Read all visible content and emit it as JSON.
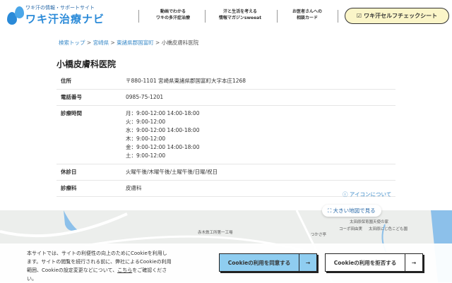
{
  "header": {
    "logo_sub": "ワキ汗の情報・サポートサイト",
    "logo_main": "ワキ汗治療ナビ",
    "nav": [
      {
        "line1": "動画でわかる",
        "line2": "ワキの多汗症治療"
      },
      {
        "line1": "汗と生活を考える",
        "line2": "情報マガジンsweeat"
      },
      {
        "line1": "お医者さんへの",
        "line2": "相談カード"
      }
    ],
    "check_icon": "☑",
    "check_label": "ワキ汗セルフチェックシート"
  },
  "breadcrumb": [
    {
      "label": "検索トップ"
    },
    {
      "label": "宮崎県"
    },
    {
      "label": "東諸県郡国富町"
    },
    {
      "label": "小橋皮膚科医院"
    }
  ],
  "breadcrumb_sep": ">",
  "clinic": {
    "name": "小橋皮膚科医院",
    "rows": {
      "address": {
        "k": "住所",
        "v": "〒880-1101 宮崎県東諸県郡国富町大字本庄1268"
      },
      "phone": {
        "k": "電話番号",
        "v": "0985-75-1201"
      },
      "hours": {
        "k": "診療時間",
        "v": [
          "月：9:00-12:00 14:00-18:00",
          "火：9:00-12:00",
          "水：9:00-12:00 14:00-18:00",
          "木：9:00-12:00",
          "金：9:00-12:00 14:00-18:00",
          "土：9:00-12:00"
        ]
      },
      "closed": {
        "k": "休診日",
        "v": "火曜午後/木曜午後/土曜午後/日曜/祝日"
      },
      "dept": {
        "k": "診療科",
        "v": "皮膚科"
      }
    }
  },
  "icon_link": "アイコンについて",
  "map": {
    "big_map": "大きい地図で見る",
    "labels": [
      "赤木鉄工所第一工場",
      "つかさ亭",
      "コーポ田由実",
      "太田原保育園天使の家",
      "太田原にじ色こども園"
    ]
  },
  "cookie": {
    "text_before": "本サイトでは、サイトの利便性の向上のためにCookieを利用します。サイトの閲覧を続行される前に、弊社によるCookieの利用範囲、Cookieの設定変更などについて、",
    "link": "こちら",
    "text_after": "をご確認ください。",
    "accept": "Cookieの利用を同意する",
    "reject": "Cookieの利用を拒否する",
    "arrow": "→",
    "accept_color": "#8fcdf0"
  }
}
